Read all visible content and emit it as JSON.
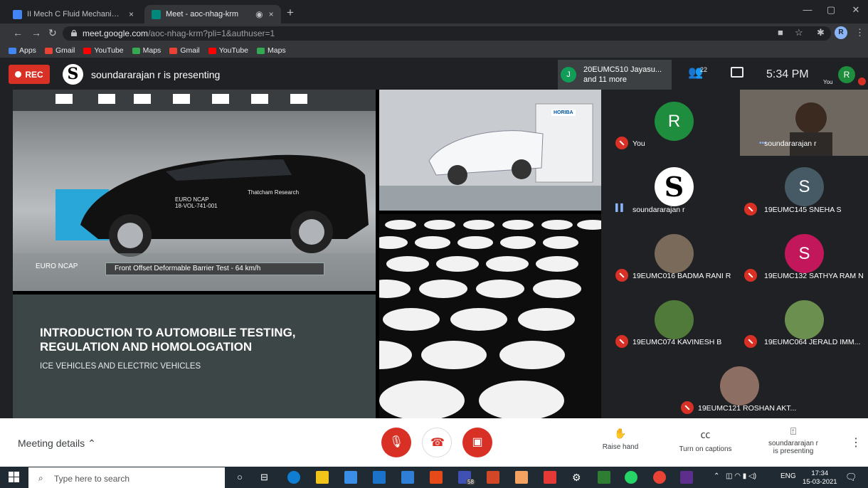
{
  "browser": {
    "tabs": [
      {
        "label": "II Mech C Fluid Mechanics and M",
        "close": "×",
        "color": "#4285f4"
      },
      {
        "label": "Meet - aoc-nhag-krm",
        "close": "×",
        "color": "#00897b"
      }
    ],
    "tab_record_icon": "◉",
    "new_tab": "+",
    "url_host": "meet.google.com",
    "url_rest": "/aoc-nhag-krm?pli=1&authuser=1",
    "profile_initial": "R",
    "bookmarks": [
      {
        "label": "Apps",
        "color": "#4285f4"
      },
      {
        "label": "Gmail",
        "color": "#ea4335"
      },
      {
        "label": "YouTube",
        "color": "#ff0000"
      },
      {
        "label": "Maps",
        "color": "#34a853"
      },
      {
        "label": "Gmail",
        "color": "#ea4335"
      },
      {
        "label": "YouTube",
        "color": "#ff0000"
      },
      {
        "label": "Maps",
        "color": "#34a853"
      }
    ]
  },
  "meet": {
    "rec_label": "REC",
    "presenter_logo": "S",
    "presenting_text": "soundararajan r is presenting",
    "join_avatar": "J",
    "join_line1": "20EUMC510 Jayasu...",
    "join_line2": "and 11 more",
    "people_count": "22",
    "clock": "5:34 PM",
    "you_label": "You",
    "you_initial": "R"
  },
  "slide": {
    "caption": "Front Offset Deformable Barrier Test - 64 km/h",
    "ncap": "EURO NCAP",
    "car_label_1": "EURO NCAP",
    "car_label_2": "18-VOL-741-001",
    "thatcham": "Thatcham Research",
    "lab_brand": "HORIBA",
    "title_line1": "INTRODUCTION TO AUTOMOBILE TESTING,",
    "title_line2": "REGULATION AND HOMOLOGATION",
    "subtitle": "ICE VEHICLES AND ELECTRIC VEHICLES"
  },
  "participants": [
    {
      "name": "You",
      "initial": "R",
      "color": "#1e8e3e",
      "state": "muted"
    },
    {
      "name": "soundararajan r",
      "initial": "",
      "color": "#5f4b3b",
      "state": "video"
    },
    {
      "name": "soundararajan r",
      "initial": "S",
      "color": "#ffffff",
      "state": "talking"
    },
    {
      "name": "19EUMC145 SNEHA S",
      "initial": "S",
      "color": "#455a64",
      "state": "muted"
    },
    {
      "name": "19EUMC016 BADMA RANI R",
      "initial": "",
      "color": "#7a6a5a",
      "state": "muted"
    },
    {
      "name": "19EUMC132 SATHYA RAM N",
      "initial": "S",
      "color": "#c2185b",
      "state": "muted"
    },
    {
      "name": "19EUMC074 KAVINESH B",
      "initial": "",
      "color": "#4f7a3a",
      "state": "muted"
    },
    {
      "name": "19EUMC064 JERALD IMM...",
      "initial": "",
      "color": "#6b8f4e",
      "state": "muted"
    },
    {
      "name": "19EUMC121 ROSHAN AKT...",
      "initial": "",
      "color": "#8d6e63",
      "state": "muted"
    }
  ],
  "controls": {
    "meeting_details": "Meeting details",
    "raise_hand": "Raise hand",
    "captions": "Turn on captions",
    "presenting_line1": "soundararajan r",
    "presenting_line2": "is presenting"
  },
  "taskbar": {
    "search_placeholder": "Type here to search",
    "badge": "58",
    "lang": "ENG",
    "time": "17:34",
    "date": "15-03-2021"
  }
}
